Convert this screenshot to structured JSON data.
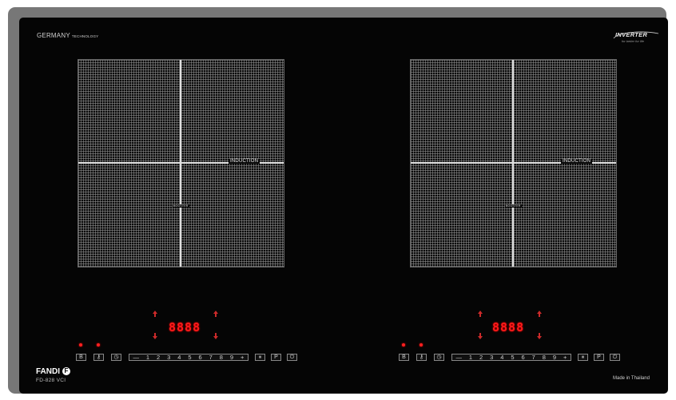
{
  "brand": {
    "tagline_main": "GERMANY",
    "tagline_small": "TECHNOLOGY",
    "inverter_text": "INVERTER",
    "inverter_sub": "for better for life",
    "name": "FANDI",
    "logo_letter": "F",
    "model": "FD-828 VCI",
    "origin": "Made in Thailand"
  },
  "zones": [
    {
      "induction_label": "INDUCTION",
      "booster_label": "BOOSTER"
    },
    {
      "induction_label": "INDUCTION",
      "booster_label": "BOOSTER"
    }
  ],
  "controls": [
    {
      "display": "8888",
      "keys": {
        "boost": "B",
        "lock": "⚷",
        "timer": "◷",
        "pause": "⏸",
        "program": "P",
        "power": "⏻"
      },
      "slider": [
        "—",
        "1",
        "2",
        "3",
        "4",
        "5",
        "6",
        "7",
        "8",
        "9",
        "+"
      ]
    },
    {
      "display": "8888",
      "keys": {
        "boost": "B",
        "lock": "⚷",
        "timer": "◷",
        "pause": "⏸",
        "program": "P",
        "power": "⏻"
      },
      "slider": [
        "—",
        "1",
        "2",
        "3",
        "4",
        "5",
        "6",
        "7",
        "8",
        "9",
        "+"
      ]
    }
  ],
  "colors": {
    "glass": "#050505",
    "frame": "#777777",
    "display_red": "#ff1a1a",
    "grid": "#969696"
  }
}
